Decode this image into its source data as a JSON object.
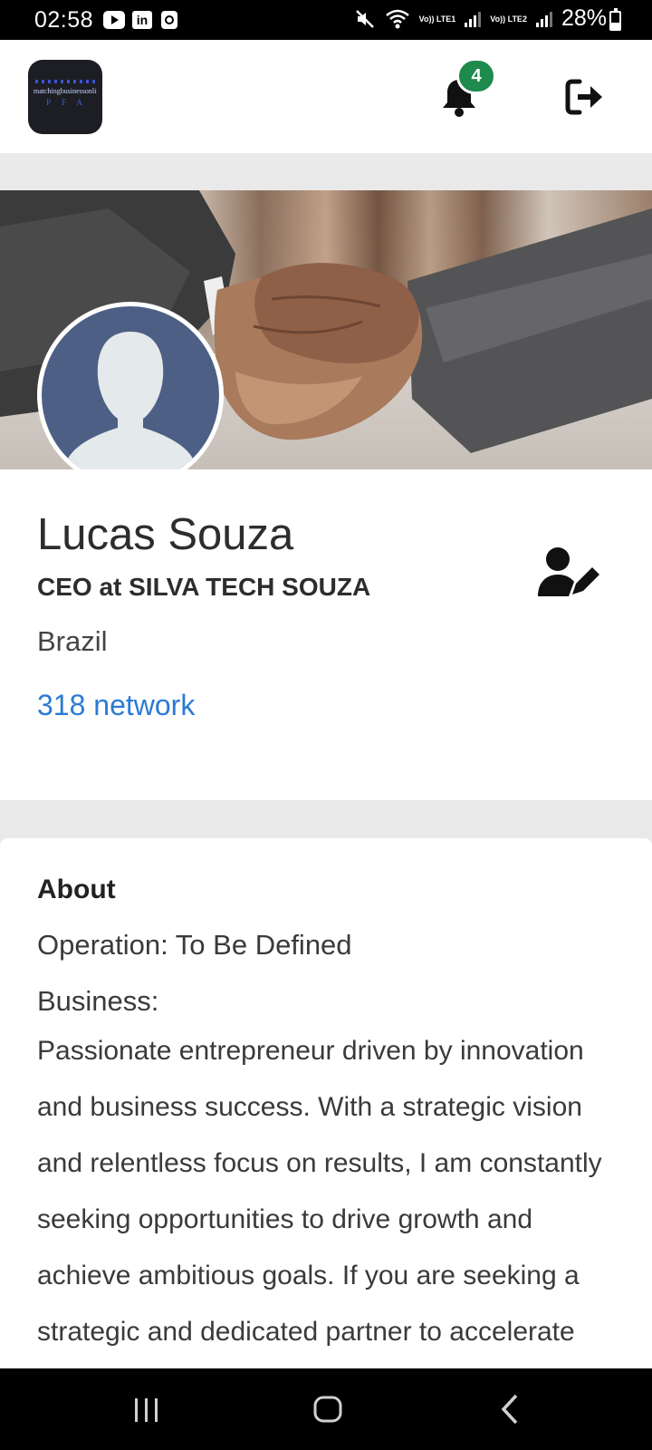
{
  "status_bar": {
    "time": "02:58",
    "app_icons": [
      "youtube-icon",
      "linkedin-icon",
      "calendar-icon"
    ],
    "linkedin_glyph": "in",
    "net1": "Vo)) LTE1",
    "net2": "Vo)) LTE2",
    "battery": "28%"
  },
  "app_bar": {
    "logo_text": "matchingbusinessonline",
    "logo_sub": "PFA",
    "notification_count": "4",
    "icons": [
      "bell-icon",
      "logout-icon"
    ]
  },
  "profile": {
    "name": "Lucas Souza",
    "title": "CEO at SILVA TECH SOUZA",
    "country": "Brazil",
    "network": "318 network",
    "edit_icon": "user-edit-icon"
  },
  "about": {
    "heading": "About",
    "operation": "Operation: To Be Defined",
    "business": "Business:",
    "bio": "Passionate entrepreneur driven by innovation and business success. With a strategic vision and relentless focus on results, I am constantly seeking opportunities to drive growth and achieve ambitious goals. If you are seeking a strategic and dedicated partner to accelerate"
  },
  "nav_bar": {
    "icons": [
      "recents-icon",
      "home-icon",
      "back-icon"
    ]
  }
}
